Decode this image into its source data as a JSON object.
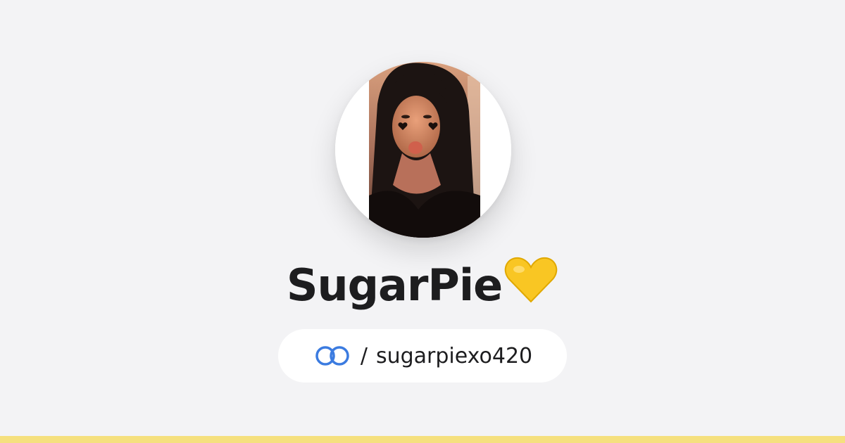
{
  "profile": {
    "display_name": "SugarPie",
    "name_emoji_icon": "yellow-heart-icon",
    "avatar_icon": "profile-photo"
  },
  "handle": {
    "link_icon": "linked-rings-icon",
    "separator": "/",
    "username": "sugarpiexo420"
  },
  "colors": {
    "background": "#f3f3f5",
    "text": "#1d1d1f",
    "accent_blue": "#3b7be0",
    "heart_yellow": "#f9c623",
    "bottom_bar": "#f5e07e"
  }
}
